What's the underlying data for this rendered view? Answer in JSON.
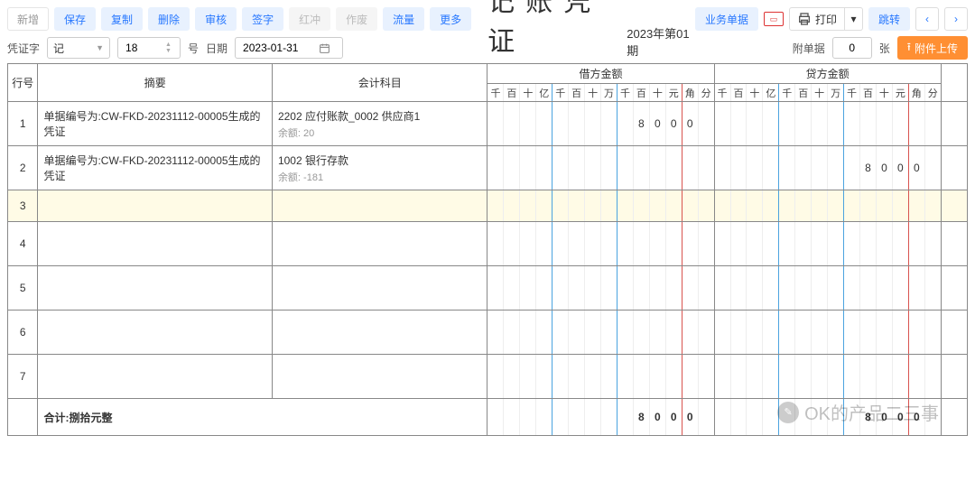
{
  "toolbar": {
    "new": "新增",
    "save": "保存",
    "copy": "复制",
    "delete": "删除",
    "audit": "审核",
    "sign": "签字",
    "reverse": "红冲",
    "void": "作废",
    "flow": "流量",
    "more": "更多",
    "biz_doc": "业务单据",
    "print": "打印",
    "jump": "跳转"
  },
  "title": "记账凭证",
  "period": "2023年第01期",
  "subbar": {
    "voucher_word_label": "凭证字",
    "voucher_word_value": "记",
    "number_value": "18",
    "number_suffix": "号",
    "date_label": "日期",
    "date_value": "2023-01-31",
    "attach_label": "附单据",
    "attach_value": "0",
    "attach_suffix": "张",
    "upload": "附件上传"
  },
  "headers": {
    "row_no": "行号",
    "summary": "摘要",
    "subject": "会计科目",
    "debit": "借方金额",
    "credit": "贷方金额",
    "digits": [
      "千",
      "百",
      "十",
      "亿",
      "千",
      "百",
      "十",
      "万",
      "千",
      "百",
      "十",
      "元",
      "角",
      "分"
    ]
  },
  "rows": [
    {
      "no": "1",
      "summary": "单据编号为:CW-FKD-20231112-00005生成的凭证",
      "subject_main": "2202  应付账款_0002 供应商1",
      "subject_bal": "余额:  20",
      "debit": [
        "",
        "",
        "",
        "",
        "",
        "",
        "",
        "",
        "",
        "8",
        "0",
        "0",
        "0",
        ""
      ],
      "credit": [
        "",
        "",
        "",
        "",
        "",
        "",
        "",
        "",
        "",
        "",
        "",
        "",
        "",
        ""
      ]
    },
    {
      "no": "2",
      "summary": "单据编号为:CW-FKD-20231112-00005生成的凭证",
      "subject_main": "1002  银行存款",
      "subject_bal": "余额:  -181",
      "debit": [
        "",
        "",
        "",
        "",
        "",
        "",
        "",
        "",
        "",
        "",
        "",
        "",
        "",
        ""
      ],
      "credit": [
        "",
        "",
        "",
        "",
        "",
        "",
        "",
        "",
        "",
        "8",
        "0",
        "0",
        "0",
        ""
      ]
    },
    {
      "no": "3",
      "blank_highlight": true
    },
    {
      "no": "4",
      "blank": true
    },
    {
      "no": "5",
      "blank": true
    },
    {
      "no": "6",
      "blank": true
    },
    {
      "no": "7",
      "blank": true
    }
  ],
  "total": {
    "label": "合计:捌拾元整",
    "debit": [
      "",
      "",
      "",
      "",
      "",
      "",
      "",
      "",
      "",
      "8",
      "0",
      "0",
      "0",
      ""
    ],
    "credit": [
      "",
      "",
      "",
      "",
      "",
      "",
      "",
      "",
      "",
      "8",
      "0",
      "0",
      "0",
      ""
    ]
  },
  "watermark": "OK的产品二三事"
}
